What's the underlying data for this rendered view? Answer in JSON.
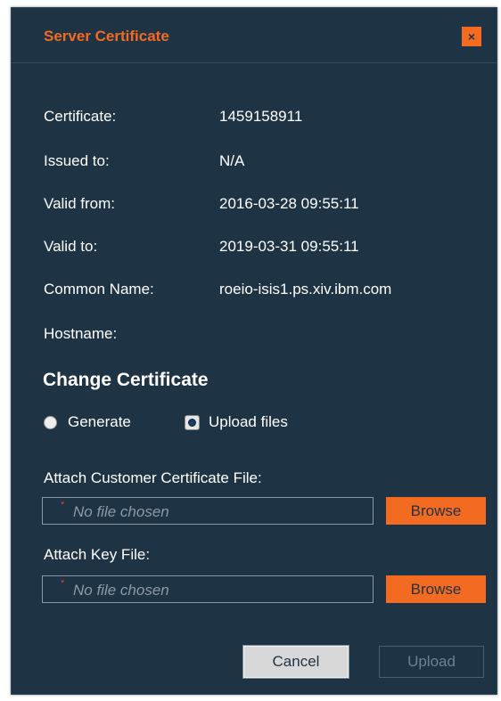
{
  "dialog": {
    "title": "Server Certificate",
    "close_glyph": "×"
  },
  "info": [
    {
      "label": "Certificate:",
      "value": "1459158911"
    },
    {
      "label": "Issued to:",
      "value": "N/A"
    },
    {
      "label": "Valid from:",
      "value": "2016-03-28 09:55:11"
    },
    {
      "label": "Valid to:",
      "value": "2019-03-31 09:55:11"
    },
    {
      "label": "Common Name:",
      "value": "roeio-isis1.ps.xiv.ibm.com"
    },
    {
      "label": "Hostname:",
      "value": ""
    }
  ],
  "change": {
    "title": "Change Certificate",
    "options": [
      {
        "label": "Generate",
        "selected": false
      },
      {
        "label": "Upload files",
        "selected": true
      }
    ]
  },
  "cert_file": {
    "label": "Attach Customer Certificate File:",
    "required_mark": "*",
    "placeholder": "No file chosen",
    "browse_label": "Browse"
  },
  "key_file": {
    "label": "Attach Key File:",
    "required_mark": "*",
    "placeholder": "No file chosen",
    "browse_label": "Browse"
  },
  "footer": {
    "cancel_label": "Cancel",
    "upload_label": "Upload",
    "upload_enabled": false
  },
  "colors": {
    "background": "#1e3344",
    "accent": "#f36b21"
  }
}
